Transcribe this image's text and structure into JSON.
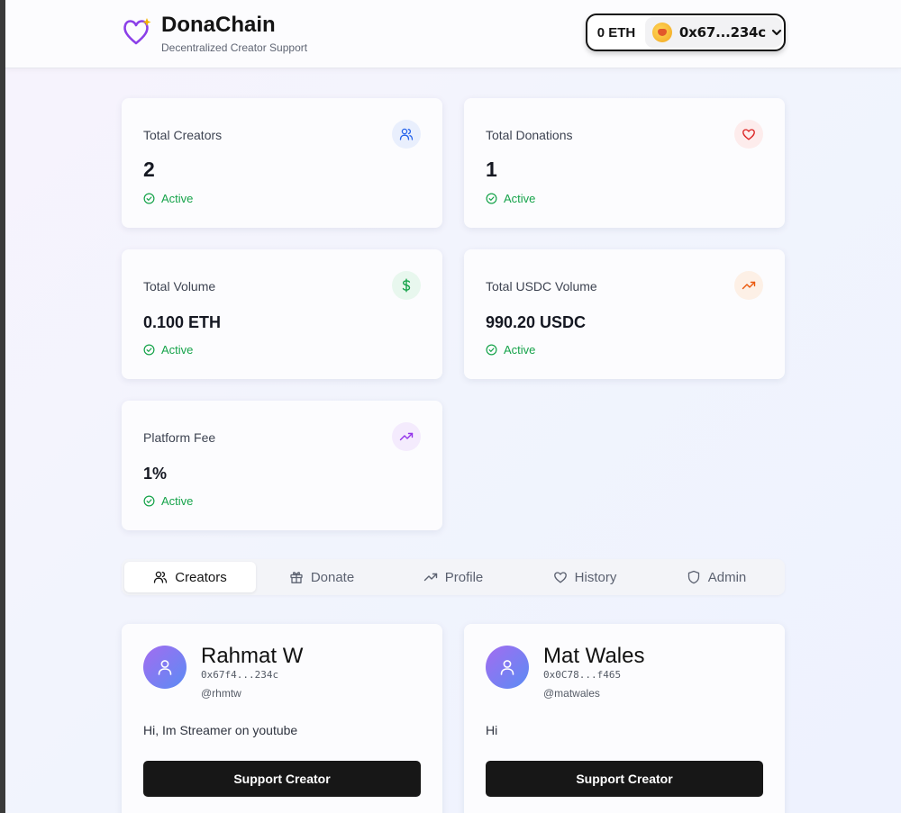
{
  "header": {
    "title": "DonaChain",
    "subtitle": "Decentralized Creator Support",
    "wallet_balance": "0 ETH",
    "wallet_address": "0x67...234c"
  },
  "stats": [
    {
      "label": "Total Creators",
      "value": "2",
      "status": "Active",
      "icon": "users-icon",
      "color": "#2563eb"
    },
    {
      "label": "Total Donations",
      "value": "1",
      "status": "Active",
      "icon": "heart-icon",
      "color": "#dc2626"
    },
    {
      "label": "Total Volume",
      "value": "0.100 ETH",
      "status": "Active",
      "icon": "dollar-icon",
      "color": "#16a34a"
    },
    {
      "label": "Total USDC Volume",
      "value": "990.20 USDC",
      "status": "Active",
      "icon": "trending-up-icon",
      "color": "#ea580c"
    },
    {
      "label": "Platform Fee",
      "value": "1%",
      "status": "Active",
      "icon": "trending-up-icon",
      "color": "#9333ea"
    }
  ],
  "tabs": [
    {
      "label": "Creators",
      "active": true
    },
    {
      "label": "Donate",
      "active": false
    },
    {
      "label": "Profile",
      "active": false
    },
    {
      "label": "History",
      "active": false
    },
    {
      "label": "Admin",
      "active": false
    }
  ],
  "creators": [
    {
      "name": "Rahmat W",
      "address": "0x67f4...234c",
      "handle": "@rhmtw",
      "bio": "Hi, Im Streamer on youtube",
      "button": "Support Creator"
    },
    {
      "name": "Mat Wales",
      "address": "0x0C78...f465",
      "handle": "@matwales",
      "bio": "Hi",
      "button": "Support Creator"
    }
  ]
}
